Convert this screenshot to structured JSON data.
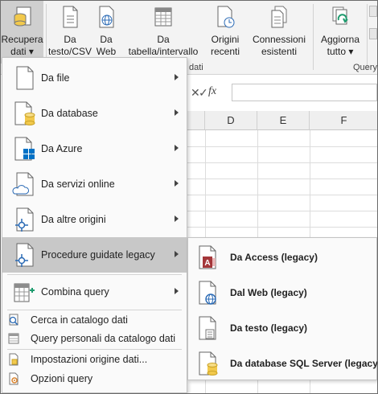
{
  "ribbon": {
    "buttons": [
      {
        "id": "recupera",
        "line1": "Recupera",
        "line2": "dati ▾",
        "icon": "database-get-icon"
      },
      {
        "id": "testo-csv",
        "line1": "Da",
        "line2": "testo/CSV",
        "icon": "text-file-icon"
      },
      {
        "id": "web",
        "line1": "Da",
        "line2": "Web",
        "icon": "web-page-icon"
      },
      {
        "id": "tabella",
        "line1": "Da",
        "line2": "tabella/intervallo",
        "icon": "table-icon"
      },
      {
        "id": "origini",
        "line1": "Origini",
        "line2": "recenti",
        "icon": "recent-sources-icon"
      },
      {
        "id": "connessioni",
        "line1": "Connessioni",
        "line2": "esistenti",
        "icon": "existing-connections-icon"
      },
      {
        "id": "aggiorna",
        "line1": "Aggiorna",
        "line2": "tutto ▾",
        "icon": "refresh-all-icon"
      }
    ],
    "group_labels": {
      "dati": "dati",
      "query": "Query"
    }
  },
  "formula_bar": {
    "cancel": "✕",
    "enter": "✓",
    "fx": "fx",
    "value": ""
  },
  "columns": [
    "D",
    "E",
    "F"
  ],
  "menu": {
    "items": [
      {
        "label": "Da file",
        "icon": "file-icon"
      },
      {
        "label": "Da database",
        "icon": "database-icon"
      },
      {
        "label": "Da Azure",
        "icon": "azure-icon"
      },
      {
        "label": "Da servizi online",
        "icon": "cloud-icon"
      },
      {
        "label": "Da altre origini",
        "icon": "other-sources-icon"
      },
      {
        "label": "Procedure guidate legacy",
        "icon": "legacy-wizard-icon"
      },
      {
        "label": "Combina query",
        "icon": "combine-query-icon"
      }
    ],
    "small_items": [
      {
        "label": "Cerca in catalogo dati",
        "icon": "search-catalog-icon"
      },
      {
        "label": "Query personali da catalogo dati",
        "icon": "catalog-query-icon"
      },
      {
        "label": "Impostazioni origine dati...",
        "icon": "data-source-settings-icon"
      },
      {
        "label": "Opzioni query",
        "icon": "query-options-icon"
      }
    ]
  },
  "submenu": {
    "items": [
      {
        "label": "Da Access (legacy)",
        "icon": "access-icon"
      },
      {
        "label": "Dal Web (legacy)",
        "icon": "web-legacy-icon"
      },
      {
        "label": "Da testo (legacy)",
        "icon": "text-legacy-icon"
      },
      {
        "label": "Da database SQL Server (legacy)",
        "icon": "sql-server-icon"
      }
    ]
  },
  "colors": {
    "selected": "#c8c8c8",
    "access_red": "#a4373a",
    "azure_blue": "#0072c6",
    "db_yellow": "#f2c94c",
    "refresh_green": "#1e9b6e"
  }
}
